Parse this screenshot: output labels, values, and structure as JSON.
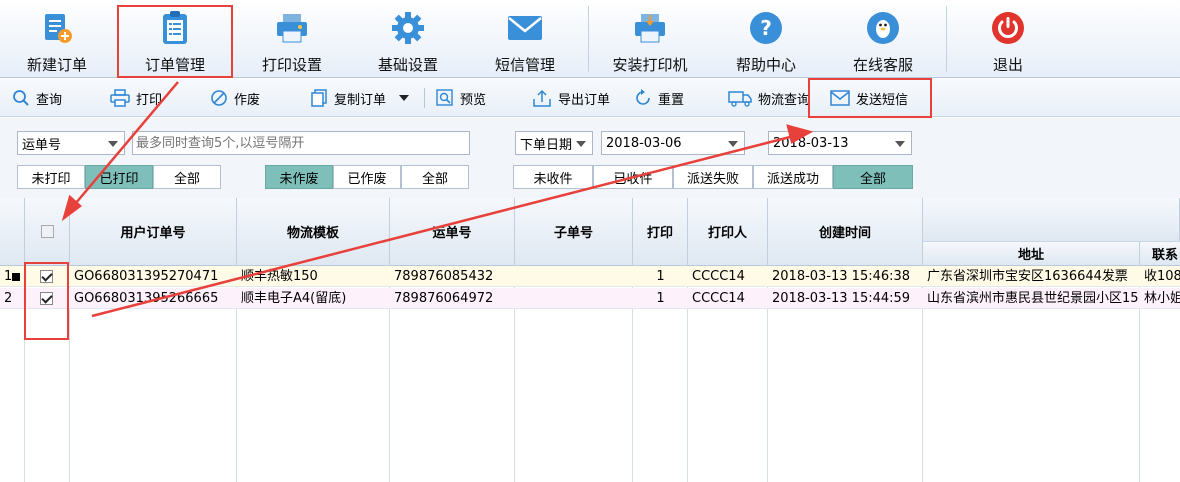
{
  "toolbar": {
    "new_order": "新建订单",
    "order_manage": "订单管理",
    "print_settings": "打印设置",
    "basic_settings": "基础设置",
    "sms_manage": "短信管理",
    "install_printer": "安装打印机",
    "help_center": "帮助中心",
    "online_service": "在线客服",
    "exit": "退出"
  },
  "actions": {
    "query": "查询",
    "print": "打印",
    "void": "作废",
    "copy_order": "复制订单",
    "preview": "预览",
    "export_order": "导出订单",
    "reset": "重置",
    "logistics_query": "物流查询",
    "send_sms": "发送短信"
  },
  "filters": {
    "search_type": "运单号",
    "search_placeholder": "最多同时查询5个,以逗号隔开",
    "date_type": "下单日期",
    "date_from": "2018-03-06",
    "date_to": "2018-03-13",
    "print_status": [
      "未打印",
      "已打印",
      "全部"
    ],
    "void_status": [
      "未作废",
      "已作废",
      "全部"
    ],
    "delivery_status": [
      "未收件",
      "已收件",
      "派送失败",
      "派送成功",
      "全部"
    ]
  },
  "table": {
    "headers": {
      "user_order_no": "用户订单号",
      "template": "物流模板",
      "waybill_no": "运单号",
      "sub_no": "子单号",
      "print": "打印",
      "printer": "打印人",
      "created": "创建时间",
      "address": "地址",
      "contact": "联系"
    },
    "rows": [
      {
        "index": "1",
        "order_no": "GO668031395270471",
        "template": "顺丰热敏150",
        "waybill": "789876085432",
        "sub_no": "",
        "print_count": "1",
        "printer": "CCCC14",
        "created": "2018-03-13 15:46:38",
        "address": "广东省深圳市宝安区1636644发票",
        "contact": "收108"
      },
      {
        "index": "2",
        "order_no": "GO668031395266665",
        "template": "顺丰电子A4(留底)",
        "waybill": "789876064972",
        "sub_no": "",
        "print_count": "1",
        "printer": "CCCC14",
        "created": "2018-03-13 15:44:59",
        "address": "山东省滨州市惠民县世纪景园小区15",
        "contact": "林小姐"
      }
    ]
  },
  "colors": {
    "accent_blue": "#2e86d4",
    "active_segment": "#7fbfba",
    "annotation_red": "#e8403a",
    "row1_bg": "#fffbe6",
    "row2_bg": "#fdf2fb"
  }
}
